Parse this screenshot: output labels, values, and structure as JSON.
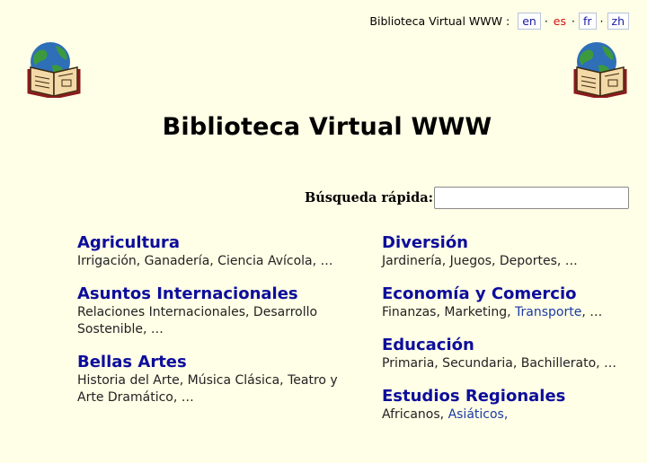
{
  "header": {
    "site_name": "Biblioteca Virtual WWW :",
    "languages": [
      {
        "code": "en",
        "current": false
      },
      {
        "code": "es",
        "current": true
      },
      {
        "code": "fr",
        "current": false
      },
      {
        "code": "zh",
        "current": false
      }
    ],
    "separator": "·"
  },
  "page_title": "Biblioteca Virtual WWW",
  "search": {
    "label": "Búsqueda rápida:",
    "value": ""
  },
  "categories_left": [
    {
      "title": "Agricultura",
      "subs": [
        {
          "text": "Irrigación, Ganadería, Ciencia Avícola, …",
          "link": false
        }
      ]
    },
    {
      "title": "Asuntos Internacionales",
      "subs": [
        {
          "text": "Relaciones Internacionales, Desarrollo Sostenible, …",
          "link": false
        }
      ]
    },
    {
      "title": "Bellas Artes",
      "subs": [
        {
          "text": "Historia del Arte, Música Clásica, Teatro y Arte Dramático, …",
          "link": false
        }
      ]
    }
  ],
  "categories_right": [
    {
      "title": "Diversión",
      "subs": [
        {
          "text": "Jardinería, Juegos, Deportes, …",
          "link": false
        }
      ]
    },
    {
      "title": "Economía y Comercio",
      "subs": [
        {
          "text": "Finanzas, Marketing, ",
          "link": false
        },
        {
          "text": "Transporte",
          "link": true
        },
        {
          "text": ", …",
          "link": false
        }
      ]
    },
    {
      "title": "Educación",
      "subs": [
        {
          "text": "Primaria, Secundaria, Bachillerato, …",
          "link": false
        }
      ]
    },
    {
      "title": "Estudios Regionales",
      "subs": [
        {
          "text": "Africanos, ",
          "link": false
        },
        {
          "text": "Asiáticos,",
          "link": true
        }
      ]
    }
  ],
  "colors": {
    "background": "#fffee6",
    "link": "#0d0d9c",
    "current_language": "#d01010"
  }
}
